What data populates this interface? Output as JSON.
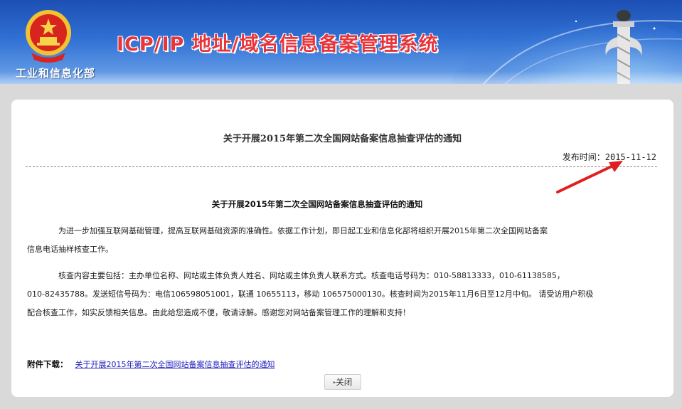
{
  "header": {
    "ministry_name": "工业和信息化部",
    "system_title": "ICP/IP 地址/域名信息备案管理系统"
  },
  "notice": {
    "title": "关于开展2015年第二次全国网站备案信息抽查评估的通知",
    "publish_label": "发布时间：",
    "publish_date": "2015-11-12",
    "content_title": "关于开展2015年第二次全国网站备案信息抽查评估的通知",
    "paragraph1_lines": [
      "为进一步加强互联网基础管理，提高互联网基础资源的准确性。依据工作计划，即日起工业和信息化部将组织开展2015年第二次全国网站备案",
      "信息电话抽样核查工作。"
    ],
    "paragraph2_lines": [
      "核查内容主要包括：主办单位名称、网站或主体负责人姓名、网站或主体负责人联系方式。核查电话号码为：010-58813333，010-61138585，",
      "010-82435788。发送短信号码为：电信106598051001，联通 10655113，移动 106575000130。核查时间为2015年11月6日至12月中旬。 请受访用户积极",
      "配合核查工作，如实反馈相关信息。由此给您造成不便，敬请谅解。感谢您对网站备案管理工作的理解和支持！"
    ]
  },
  "attachment": {
    "label": "附件下载：",
    "link_text": "关于开展2015年第二次全国网站备案信息抽查评估的通知"
  },
  "buttons": {
    "close_label": "关闭"
  },
  "colors": {
    "banner_blue": "#2f6fd3",
    "title_red": "#e8353b",
    "arrow_red": "#e02020",
    "link_blue": "#2020c0"
  }
}
